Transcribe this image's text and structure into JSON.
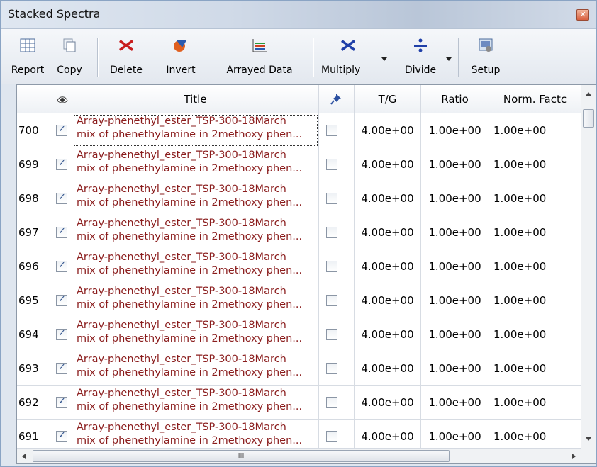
{
  "window": {
    "title": "Stacked Spectra"
  },
  "toolbar": {
    "report": "Report",
    "copy": "Copy",
    "delete": "Delete",
    "invert": "Invert",
    "arrayed": "Arrayed Data",
    "multiply": "Multiply",
    "divide": "Divide",
    "setup": "Setup"
  },
  "columns": {
    "title": "Title",
    "tg": "T/G",
    "ratio": "Ratio",
    "norm": "Norm. Factc"
  },
  "rows": [
    {
      "num": "700",
      "line1": "Array-phenethyl_ester_TSP-300-18March",
      "line2": "mix of phenethylamine in 2methoxy phen...",
      "tg": "4.00e+00",
      "ratio": "1.00e+00",
      "norm": "1.00e+00"
    },
    {
      "num": "699",
      "line1": "Array-phenethyl_ester_TSP-300-18March",
      "line2": "mix of phenethylamine in 2methoxy phen...",
      "tg": "4.00e+00",
      "ratio": "1.00e+00",
      "norm": "1.00e+00"
    },
    {
      "num": "698",
      "line1": "Array-phenethyl_ester_TSP-300-18March",
      "line2": "mix of phenethylamine in 2methoxy phen...",
      "tg": "4.00e+00",
      "ratio": "1.00e+00",
      "norm": "1.00e+00"
    },
    {
      "num": "697",
      "line1": "Array-phenethyl_ester_TSP-300-18March",
      "line2": "mix of phenethylamine in 2methoxy phen...",
      "tg": "4.00e+00",
      "ratio": "1.00e+00",
      "norm": "1.00e+00"
    },
    {
      "num": "696",
      "line1": "Array-phenethyl_ester_TSP-300-18March",
      "line2": "mix of phenethylamine in 2methoxy phen...",
      "tg": "4.00e+00",
      "ratio": "1.00e+00",
      "norm": "1.00e+00"
    },
    {
      "num": "695",
      "line1": "Array-phenethyl_ester_TSP-300-18March",
      "line2": "mix of phenethylamine in 2methoxy phen...",
      "tg": "4.00e+00",
      "ratio": "1.00e+00",
      "norm": "1.00e+00"
    },
    {
      "num": "694",
      "line1": "Array-phenethyl_ester_TSP-300-18March",
      "line2": "mix of phenethylamine in 2methoxy phen...",
      "tg": "4.00e+00",
      "ratio": "1.00e+00",
      "norm": "1.00e+00"
    },
    {
      "num": "693",
      "line1": "Array-phenethyl_ester_TSP-300-18March",
      "line2": "mix of phenethylamine in 2methoxy phen...",
      "tg": "4.00e+00",
      "ratio": "1.00e+00",
      "norm": "1.00e+00"
    },
    {
      "num": "692",
      "line1": "Array-phenethyl_ester_TSP-300-18March",
      "line2": "mix of phenethylamine in 2methoxy phen...",
      "tg": "4.00e+00",
      "ratio": "1.00e+00",
      "norm": "1.00e+00"
    },
    {
      "num": "691",
      "line1": "Array-phenethyl_ester_TSP-300-18March",
      "line2": "mix of phenethylamine in 2methoxy phen...",
      "tg": "4.00e+00",
      "ratio": "1.00e+00",
      "norm": "1.00e+00"
    }
  ],
  "scrollbar": {
    "h_thumb_label": "III"
  },
  "icons": {
    "report": "grid-icon",
    "copy": "copy-icon",
    "delete": "x-icon",
    "invert": "invert-icon",
    "arrayed": "arrayed-icon",
    "multiply": "multiply-icon",
    "divide": "divide-icon",
    "setup": "setup-icon",
    "visible": "eye-icon",
    "pin": "pin-icon"
  },
  "colors": {
    "title_text": "#8a1c1c",
    "delete": "#c81d1d",
    "multiply": "#1f3fa8"
  }
}
